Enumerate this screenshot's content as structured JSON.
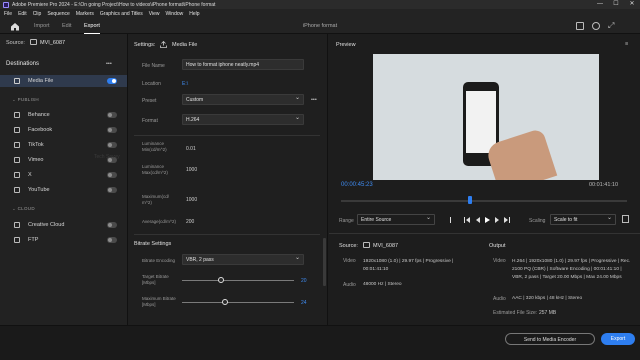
{
  "window": {
    "title": "Adobe Premiere Pro 2024 - E:\\On going Project\\How to videos\\iPhone format\\iPhone format",
    "controls": [
      "—",
      "☐",
      "✕"
    ]
  },
  "menu": [
    "File",
    "Edit",
    "Clip",
    "Sequence",
    "Markers",
    "Graphics and Titles",
    "View",
    "Window",
    "Help"
  ],
  "nav": {
    "tabs": [
      "Import",
      "Edit",
      "Export"
    ],
    "active_tab": "Export",
    "project_name": "iPhone format"
  },
  "source_header": {
    "label": "Source:",
    "name": "MVI_6087"
  },
  "destinations": {
    "title": "Destinations",
    "more": "•••",
    "media_file": {
      "label": "Media File",
      "enabled": true
    },
    "publish_title": "PUBLISH",
    "publish": [
      {
        "label": "Behance",
        "icon": "behance-icon",
        "enabled": false
      },
      {
        "label": "Facebook",
        "icon": "facebook-icon",
        "enabled": false
      },
      {
        "label": "TikTok",
        "icon": "tiktok-icon",
        "enabled": false
      },
      {
        "label": "Vimeo",
        "icon": "vimeo-icon",
        "enabled": false
      },
      {
        "label": "X",
        "icon": "x-icon",
        "enabled": false
      },
      {
        "label": "YouTube",
        "icon": "youtube-icon",
        "enabled": false
      }
    ],
    "cloud_title": "CLOUD",
    "cloud": [
      {
        "label": "Creative Cloud",
        "icon": "creative-cloud-icon",
        "enabled": false
      },
      {
        "label": "FTP",
        "icon": "ftp-icon",
        "enabled": false
      }
    ]
  },
  "settings": {
    "header": "Settings:",
    "header_target": "Media File",
    "file_name_label": "File Name",
    "file_name_value": "How to format iphone neatly.mp4",
    "location_label": "Location",
    "location_value": "E:\\",
    "preset_label": "Preset",
    "preset_value": "Custom",
    "preset_more": "•••",
    "format_label": "Format",
    "format_value": "H.264",
    "luminance_min_label": "Luminance Min(cd/m^2)",
    "luminance_min_value": "0.01",
    "luminance_max_label": "Luminance Max(cd/m^2)",
    "luminance_max_value": "1000",
    "maximum_label": "Maximum(cd/ m^2)",
    "maximum_value": "1000",
    "average_label": "Average(cd/m^2)",
    "average_value": "200",
    "bitrate_header": "Bitrate Settings",
    "bitrate_encoding_label": "Bitrate Encoding",
    "bitrate_encoding_value": "VBR, 2 pass",
    "target_bitrate_label": "Target Bitrate [Mbps]",
    "target_bitrate_value": "20",
    "target_bitrate_level": 0.35,
    "max_bitrate_label": "Maximum Bitrate [Mbps]",
    "max_bitrate_value": "24",
    "max_bitrate_level": 0.38,
    "watermark": "Tech Savvy"
  },
  "preview": {
    "title": "Preview",
    "more": "≡",
    "current_time": "00:00:45:23",
    "duration": "00:01:41:10",
    "playhead_fraction": 0.45,
    "range_label": "Range",
    "range_value": "Entire Source",
    "scaling_label": "Scaling",
    "scaling_value": "Scale to fit"
  },
  "source_info": {
    "title": "Source:",
    "name": "MVI_6087",
    "video_label": "Video",
    "video_value": "1920x1080 (1.0) | 29.97 fps | Progressive | 00:01:41:10",
    "audio_label": "Audio",
    "audio_value": "48000 Hz | Stereo"
  },
  "output_info": {
    "title": "Output",
    "video_label": "Video",
    "video_value": "H.264 | 1920x1080 (1.0) | 29.97 fps | Progressive | Rec. 2100 PQ (CBR) | Software Encoding | 00:01:41:10 | VBR, 2 pass | Target 20.00 Mbps | Max 24.00 Mbps",
    "audio_label": "Audio",
    "audio_value": "AAC | 320 kbps | 48 kHz | Stereo",
    "size_label": "Estimated File Size:",
    "size_value": "257 MB"
  },
  "footer": {
    "encoder_button": "Send to Media Encoder",
    "export_button": "Export"
  },
  "colors": {
    "accent": "#2e7ef0",
    "timecode": "#3f8cf3",
    "selected_row": "#2f3a4d"
  }
}
